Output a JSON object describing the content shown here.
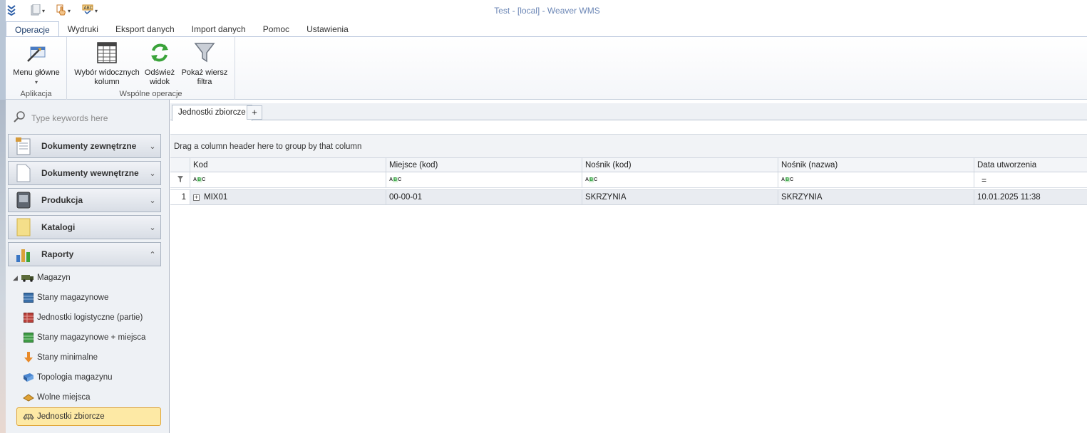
{
  "window": {
    "title": "Test - [local] - Weaver WMS"
  },
  "ribbon": {
    "tabs": [
      "Operacje",
      "Wydruki",
      "Eksport danych",
      "Import danych",
      "Pomoc",
      "Ustawienia"
    ],
    "active_tab": "Operacje",
    "groups": [
      {
        "label": "Aplikacja",
        "buttons": [
          {
            "label": "Menu główne",
            "icon": "main-menu-icon"
          }
        ]
      },
      {
        "label": "Wspólne operacje",
        "buttons": [
          {
            "label": "Wybór widocznych kolumn",
            "icon": "columns-icon"
          },
          {
            "label": "Odśwież widok",
            "icon": "refresh-icon"
          },
          {
            "label": "Pokaż wiersz filtra",
            "icon": "filter-icon"
          }
        ]
      }
    ]
  },
  "sidebar": {
    "search_placeholder": "Type keywords here",
    "groups": [
      {
        "label": "Dokumenty zewnętrzne",
        "icon": "external-docs-icon",
        "expanded": false
      },
      {
        "label": "Dokumenty wewnętrzne",
        "icon": "internal-docs-icon",
        "expanded": false
      },
      {
        "label": "Produkcja",
        "icon": "production-icon",
        "expanded": false
      },
      {
        "label": "Katalogi",
        "icon": "catalogs-icon",
        "expanded": false
      },
      {
        "label": "Raporty",
        "icon": "reports-icon",
        "expanded": true
      }
    ],
    "tree": {
      "parent": "Magazyn",
      "items": [
        "Stany magazynowe",
        "Jednostki logistyczne (partie)",
        "Stany magazynowe + miejsca",
        "Stany minimalne",
        "Topologia magazynu",
        "Wolne miejsca",
        "Jednostki zbiorcze"
      ],
      "selected": "Jednostki zbiorcze"
    }
  },
  "content": {
    "tab": "Jednostki zbiorcze",
    "add_tab": "+",
    "group_hint": "Drag a column header here to group by that column",
    "columns": [
      "Kod",
      "Miejsce (kod)",
      "Nośnik (kod)",
      "Nośnik (nazwa)",
      "Data utworzenia"
    ],
    "rows": [
      {
        "num": "1",
        "kod": "MIX01",
        "miejsce": "00-00-01",
        "nosnik_kod": "SKRZYNIA",
        "nosnik_nazwa": "SKRZYNIA",
        "data": "10.01.2025 11:38"
      }
    ],
    "date_filter_symbol": "="
  },
  "colors": {
    "selected_bg": "#fde9a5",
    "selected_border": "#e0a63a",
    "title_text": "#6b86b5"
  }
}
